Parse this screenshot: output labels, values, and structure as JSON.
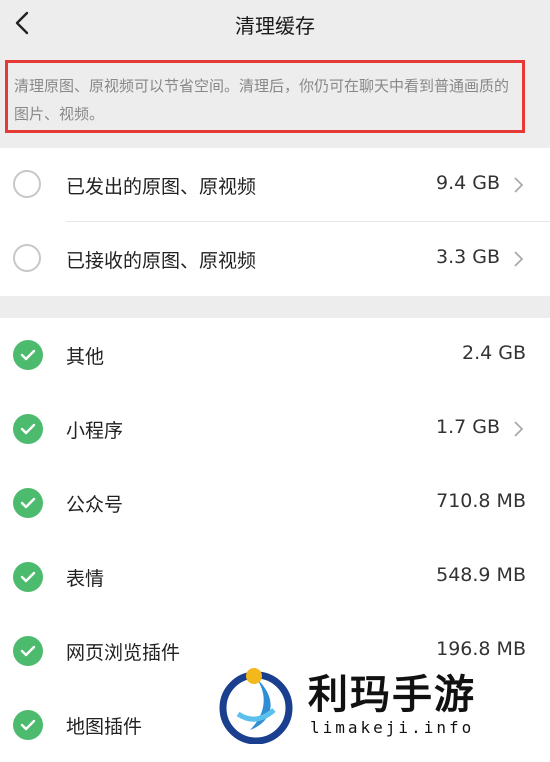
{
  "header": {
    "title": "清理缓存"
  },
  "notice": {
    "text": "清理原图、原视频可以节省空间。清理后，你仍可在聊天中看到普通画质的图片、视频。"
  },
  "original_media": [
    {
      "label": "已发出的原图、原视频",
      "size": "9.4 GB",
      "checked": false
    },
    {
      "label": "已接收的原图、原视频",
      "size": "3.3 GB",
      "checked": false
    }
  ],
  "other_items": [
    {
      "label": "其他",
      "size": "2.4 GB",
      "checked": true
    },
    {
      "label": "小程序",
      "size": "1.7 GB",
      "checked": true
    },
    {
      "label": "公众号",
      "size": "710.8 MB",
      "checked": true
    },
    {
      "label": "表情",
      "size": "548.9 MB",
      "checked": true
    },
    {
      "label": "网页浏览插件",
      "size": "196.8 MB",
      "checked": true
    },
    {
      "label": "地图插件",
      "size": "",
      "checked": true
    }
  ],
  "watermark": {
    "brand": "利玛手游",
    "domain": "limakeji.info"
  },
  "colors": {
    "accent_green": "#4dbb6d",
    "highlight_red": "#e53935"
  }
}
